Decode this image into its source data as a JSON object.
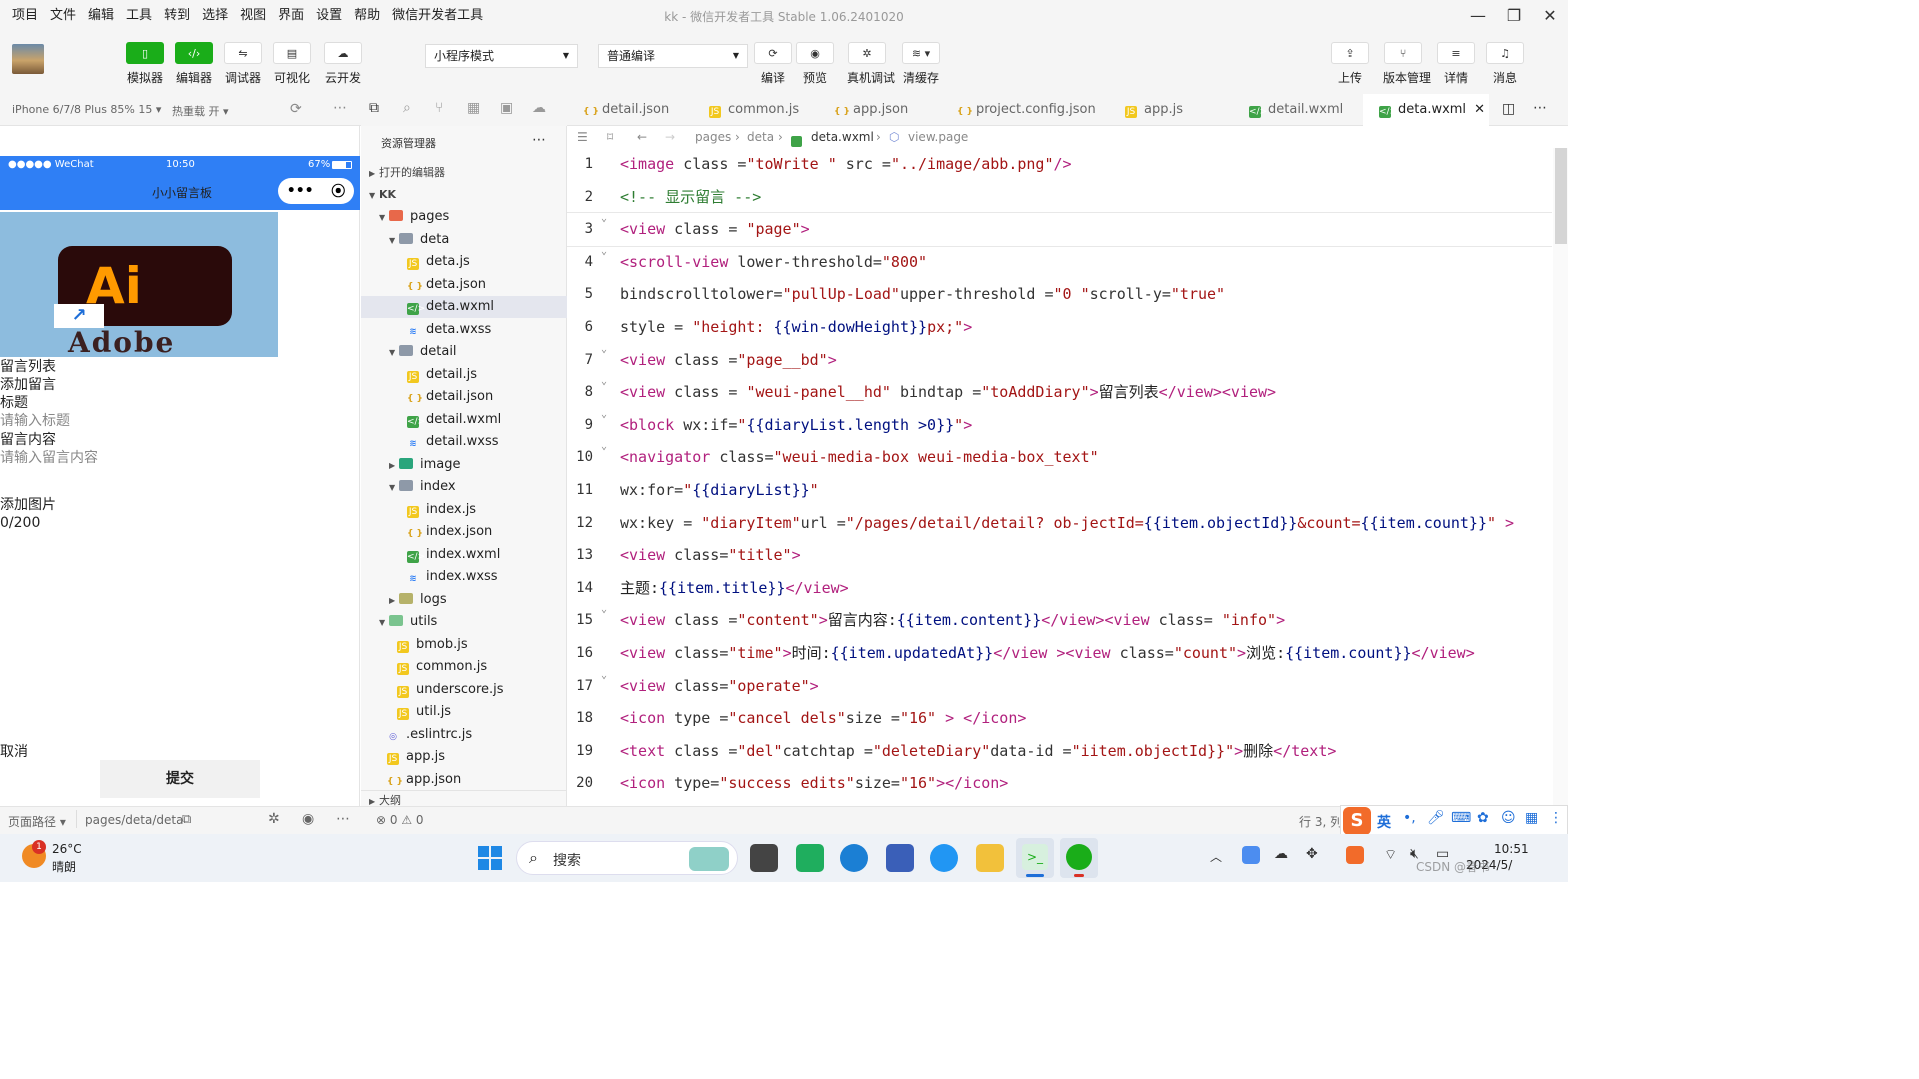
{
  "menubar": [
    "项目",
    "文件",
    "编辑",
    "工具",
    "转到",
    "选择",
    "视图",
    "界面",
    "设置",
    "帮助",
    "微信开发者工具"
  ],
  "window": {
    "title": "kk - 微信开发者工具 Stable 1.06.2401020"
  },
  "toolbar": {
    "left_buttons": [
      {
        "label": "模拟器",
        "icon": "phone-icon"
      },
      {
        "label": "编辑器",
        "icon": "code-icon"
      },
      {
        "label": "调试器",
        "icon": "debug-icon"
      },
      {
        "label": "可视化",
        "icon": "layout-icon"
      },
      {
        "label": "云开发",
        "icon": "cloud-icon"
      }
    ],
    "mode_select": "小程序模式",
    "compile_select": "普通编译",
    "mid_buttons": [
      {
        "label": "编译",
        "icon": "refresh-icon"
      },
      {
        "label": "预览",
        "icon": "eye-icon"
      },
      {
        "label": "真机调试",
        "icon": "bug-icon"
      },
      {
        "label": "清缓存",
        "icon": "layers-icon"
      }
    ],
    "right_buttons": [
      {
        "label": "上传",
        "icon": "upload-icon"
      },
      {
        "label": "版本管理",
        "icon": "branch-icon"
      },
      {
        "label": "详情",
        "icon": "menu-icon"
      },
      {
        "label": "消息",
        "icon": "bell-icon"
      }
    ]
  },
  "subbar": {
    "device": "iPhone 6/7/8 Plus 85% 15 ▾",
    "hotreload": "热重载 开 ▾"
  },
  "simulator": {
    "status_left": "●●●●● WeChat",
    "status_time": "10:50",
    "status_battery": "67%",
    "nav_title": "小小留言板",
    "image_ai": "Ai",
    "image_brand": "Adobe",
    "items": [
      {
        "text": "留言列表",
        "placeholder": false
      },
      {
        "text": "添加留言",
        "placeholder": false
      },
      {
        "text": "标题",
        "placeholder": false
      },
      {
        "text": "请输入标题",
        "placeholder": true
      },
      {
        "text": "留言内容",
        "placeholder": false
      },
      {
        "text": "请输入留言内容",
        "placeholder": true
      }
    ],
    "add_image": "添加图片",
    "counter": "0/200",
    "cancel": "取消",
    "submit": "提交"
  },
  "explorer": {
    "title": "资源管理器",
    "open_editors": "打开的编辑器",
    "project": "KK",
    "outline": "大纲",
    "tree": [
      {
        "name": "pages",
        "type": "folder-red",
        "depth": 1,
        "open": true
      },
      {
        "name": "deta",
        "type": "folder",
        "depth": 2,
        "open": true
      },
      {
        "name": "deta.js",
        "type": "js",
        "depth": 3
      },
      {
        "name": "deta.json",
        "type": "json",
        "depth": 3
      },
      {
        "name": "deta.wxml",
        "type": "wxml",
        "depth": 3,
        "selected": true
      },
      {
        "name": "deta.wxss",
        "type": "wxss",
        "depth": 3
      },
      {
        "name": "detail",
        "type": "folder",
        "depth": 2,
        "open": true
      },
      {
        "name": "detail.js",
        "type": "js",
        "depth": 3
      },
      {
        "name": "detail.json",
        "type": "json",
        "depth": 3
      },
      {
        "name": "detail.wxml",
        "type": "wxml",
        "depth": 3
      },
      {
        "name": "detail.wxss",
        "type": "wxss",
        "depth": 3
      },
      {
        "name": "image",
        "type": "folder-green",
        "depth": 2,
        "open": false
      },
      {
        "name": "index",
        "type": "folder",
        "depth": 2,
        "open": true
      },
      {
        "name": "index.js",
        "type": "js",
        "depth": 3
      },
      {
        "name": "index.json",
        "type": "json",
        "depth": 3
      },
      {
        "name": "index.wxml",
        "type": "wxml",
        "depth": 3
      },
      {
        "name": "index.wxss",
        "type": "wxss",
        "depth": 3
      },
      {
        "name": "logs",
        "type": "folder-yel",
        "depth": 2,
        "open": false
      },
      {
        "name": "utils",
        "type": "folder-lgreen",
        "depth": 1,
        "open": true
      },
      {
        "name": "bmob.js",
        "type": "js",
        "depth": 2
      },
      {
        "name": "common.js",
        "type": "js",
        "depth": 2
      },
      {
        "name": "underscore.js",
        "type": "js",
        "depth": 2
      },
      {
        "name": "util.js",
        "type": "js",
        "depth": 2
      },
      {
        "name": ".eslintrc.js",
        "type": "eslint",
        "depth": 1
      },
      {
        "name": "app.js",
        "type": "js",
        "depth": 1
      },
      {
        "name": "app.json",
        "type": "json",
        "depth": 1
      }
    ]
  },
  "tabs": [
    {
      "name": "detail.json",
      "type": "json",
      "active": false
    },
    {
      "name": "common.js",
      "type": "js",
      "active": false
    },
    {
      "name": "app.json",
      "type": "json",
      "active": false
    },
    {
      "name": "project.config.json",
      "type": "json",
      "active": false
    },
    {
      "name": "app.js",
      "type": "js",
      "active": false
    },
    {
      "name": "detail.wxml",
      "type": "wxml",
      "active": false
    },
    {
      "name": "deta.wxml",
      "type": "wxml",
      "active": true
    }
  ],
  "breadcrumb": [
    "pages",
    "deta",
    "deta.wxml",
    "view.page"
  ],
  "code_lines": [
    {
      "n": 1,
      "fold": false,
      "tokens": [
        [
          "tag",
          "<image"
        ],
        [
          "attr",
          " class ="
        ],
        [
          "str",
          "\"toWrite \""
        ],
        [
          "attr",
          " src ="
        ],
        [
          "str",
          "\"../image/abb.png\""
        ],
        [
          "tag",
          "/>"
        ]
      ]
    },
    {
      "n": 2,
      "fold": false,
      "tokens": [
        [
          "cmt",
          "<!-- 显示留言 -->"
        ]
      ]
    },
    {
      "n": 3,
      "fold": true,
      "tokens": [
        [
          "tag",
          "<view"
        ],
        [
          "attr",
          " class = "
        ],
        [
          "str",
          "\"page\""
        ],
        [
          "tag",
          ">"
        ]
      ]
    },
    {
      "n": 4,
      "fold": true,
      "tokens": [
        [
          "tag",
          "<scroll-view"
        ],
        [
          "attr",
          " lower-threshold="
        ],
        [
          "str",
          "\"800\""
        ]
      ]
    },
    {
      "n": 5,
      "fold": false,
      "tokens": [
        [
          "attr",
          "bindscrolltolower="
        ],
        [
          "str",
          "\"pullUp-Load\""
        ],
        [
          "attr",
          "upper-threshold ="
        ],
        [
          "str",
          "\"0 \""
        ],
        [
          "attr",
          "scroll-y="
        ],
        [
          "str",
          "\"true\""
        ]
      ]
    },
    {
      "n": 6,
      "fold": false,
      "tokens": [
        [
          "attr",
          "style = "
        ],
        [
          "str",
          "\"height: "
        ],
        [
          "exp",
          "{{win-dowHeight}}"
        ],
        [
          "str",
          "px;\""
        ],
        [
          "tag",
          ">"
        ]
      ]
    },
    {
      "n": 7,
      "fold": true,
      "tokens": [
        [
          "tag",
          "<view"
        ],
        [
          "attr",
          " class ="
        ],
        [
          "str",
          "\"page__bd\""
        ],
        [
          "tag",
          ">"
        ]
      ]
    },
    {
      "n": 8,
      "fold": true,
      "tokens": [
        [
          "tag",
          "<view"
        ],
        [
          "attr",
          " class = "
        ],
        [
          "str",
          "\"weui-panel__hd\""
        ],
        [
          "attr",
          " bindtap ="
        ],
        [
          "str",
          "\"toAddDiary\""
        ],
        [
          "tag",
          ">"
        ],
        [
          "txt",
          "留言列表"
        ],
        [
          "tag",
          "</view><view>"
        ]
      ]
    },
    {
      "n": 9,
      "fold": true,
      "tokens": [
        [
          "tag",
          "<block"
        ],
        [
          "attr",
          " wx:if="
        ],
        [
          "str",
          "\""
        ],
        [
          "exp",
          "{{diaryList.length >0}}"
        ],
        [
          "str",
          "\""
        ],
        [
          "tag",
          ">"
        ]
      ]
    },
    {
      "n": 10,
      "fold": true,
      "tokens": [
        [
          "tag",
          "<navigator"
        ],
        [
          "attr",
          " class="
        ],
        [
          "str",
          "\"weui-media-box weui-media-box_text\""
        ]
      ]
    },
    {
      "n": 11,
      "fold": false,
      "tokens": [
        [
          "attr",
          "wx:for="
        ],
        [
          "str",
          "\""
        ],
        [
          "exp",
          "{{diaryList}}"
        ],
        [
          "str",
          "\""
        ]
      ]
    },
    {
      "n": 12,
      "fold": false,
      "tokens": [
        [
          "attr",
          "wx:key = "
        ],
        [
          "str",
          "\"diaryItem\""
        ],
        [
          "attr",
          "url ="
        ],
        [
          "str",
          "\"/pages/detail/detail? ob-jectId="
        ],
        [
          "exp",
          "{{item.objectId}}"
        ],
        [
          "str",
          "&count="
        ],
        [
          "exp",
          "{{item.count}}"
        ],
        [
          "str",
          "\""
        ],
        [
          "tag",
          " >"
        ]
      ]
    },
    {
      "n": 13,
      "fold": false,
      "tokens": [
        [
          "tag",
          "<view"
        ],
        [
          "attr",
          " class="
        ],
        [
          "str",
          "\"title\""
        ],
        [
          "tag",
          ">"
        ]
      ]
    },
    {
      "n": 14,
      "fold": false,
      "tokens": [
        [
          "txt",
          "主题:"
        ],
        [
          "exp",
          "{{item.title}}"
        ],
        [
          "tag",
          "</view>"
        ]
      ]
    },
    {
      "n": 15,
      "fold": true,
      "tokens": [
        [
          "tag",
          "<view"
        ],
        [
          "attr",
          " class ="
        ],
        [
          "str",
          "\"content\""
        ],
        [
          "tag",
          ">"
        ],
        [
          "txt",
          "留言内容:"
        ],
        [
          "exp",
          "{{item.content}}"
        ],
        [
          "tag",
          "</view><view"
        ],
        [
          "attr",
          " class= "
        ],
        [
          "str",
          "\"info\""
        ],
        [
          "tag",
          ">"
        ]
      ]
    },
    {
      "n": 16,
      "fold": false,
      "tokens": [
        [
          "tag",
          "<view"
        ],
        [
          "attr",
          " class="
        ],
        [
          "str",
          "\"time\""
        ],
        [
          "tag",
          ">"
        ],
        [
          "txt",
          "时间:"
        ],
        [
          "exp",
          "{{item.updatedAt}}"
        ],
        [
          "tag",
          "</view ><view"
        ],
        [
          "attr",
          " class="
        ],
        [
          "str",
          "\"count\""
        ],
        [
          "tag",
          ">"
        ],
        [
          "txt",
          "浏览:"
        ],
        [
          "exp",
          "{{item.count}}"
        ],
        [
          "tag",
          "</view>"
        ]
      ]
    },
    {
      "n": 17,
      "fold": true,
      "tokens": [
        [
          "tag",
          "<view"
        ],
        [
          "attr",
          " class="
        ],
        [
          "str",
          "\"operate\""
        ],
        [
          "tag",
          ">"
        ]
      ]
    },
    {
      "n": 18,
      "fold": false,
      "tokens": [
        [
          "tag",
          "<icon"
        ],
        [
          "attr",
          " type ="
        ],
        [
          "str",
          "\"cancel dels\""
        ],
        [
          "attr",
          "size ="
        ],
        [
          "str",
          "\"16\""
        ],
        [
          "tag",
          " > </icon>"
        ]
      ]
    },
    {
      "n": 19,
      "fold": false,
      "tokens": [
        [
          "tag",
          "<text"
        ],
        [
          "attr",
          " class ="
        ],
        [
          "str",
          "\"del\""
        ],
        [
          "attr",
          "catchtap ="
        ],
        [
          "str",
          "\"deleteDiary\""
        ],
        [
          "attr",
          "data-id ="
        ],
        [
          "str",
          "\"iitem.objectId}}\""
        ],
        [
          "tag",
          ">"
        ],
        [
          "txt",
          "删除"
        ],
        [
          "tag",
          "</text>"
        ]
      ]
    },
    {
      "n": 20,
      "fold": false,
      "tokens": [
        [
          "tag",
          "<icon"
        ],
        [
          "attr",
          " type="
        ],
        [
          "str",
          "\"success edits\""
        ],
        [
          "attr",
          "size="
        ],
        [
          "str",
          "\"16\""
        ],
        [
          "tag",
          "></icon>"
        ]
      ]
    }
  ],
  "sim_status": {
    "path_label": "页面路径 ▾",
    "path": "pages/deta/deta"
  },
  "edit_status": {
    "problems": "⊗ 0 ⚠ 0",
    "position": "行 3, 列"
  },
  "taskbar": {
    "weather_temp": "26°C",
    "weather_desc": "晴朗",
    "weather_badge": "1",
    "search": "搜索",
    "time": "10:51",
    "date": "2024/5/",
    "ime": "英",
    "watermark": "CSDN @春书"
  },
  "colors": {
    "accent": "#1aad19",
    "phone_bar": "#2f7ff5"
  }
}
